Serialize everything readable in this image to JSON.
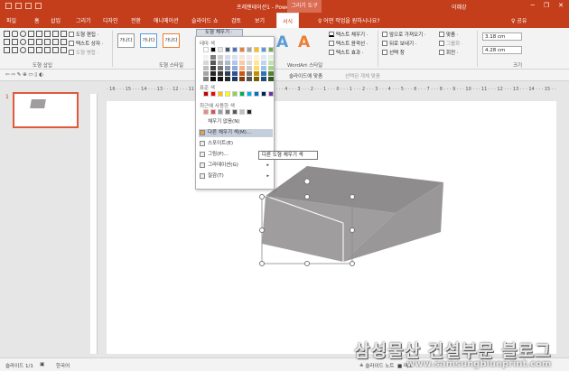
{
  "titlebar": {
    "title": "프레젠테이션1 - PowerPoint",
    "contextual_tab": "그리기 도구",
    "user": "이혜강",
    "minimize": "─",
    "restore": "❐",
    "close": "✕"
  },
  "tabs": {
    "items": [
      "파일",
      "홈",
      "삽입",
      "그리기",
      "디자인",
      "전환",
      "애니메이션",
      "슬라이드 쇼",
      "검토",
      "보기"
    ],
    "active": "서식",
    "tell_me": "♀ 어떤 작업을 원하시나요?",
    "share": "♀ 공유"
  },
  "ribbon": {
    "groups": {
      "insert_shapes": "도형 삽입",
      "shape_styles": "도형 스타일",
      "wordart_styles": "WordArt 스타일",
      "size": "크기"
    },
    "buttons": {
      "edit_shape": "도형 편집 ·",
      "text_box": "텍스트 상자 ·",
      "merge_shapes": "도형 병합 ·",
      "text_fill": "텍스트 채우기 ·",
      "text_outline": "텍스트 윤곽선 ·",
      "text_effects": "텍스트 효과 ·",
      "bring_forward": "앞으로 가져오기 ·",
      "send_backward": "뒤로 보내기 ·",
      "selection_pane": "선택 창",
      "align": "맞춤 ·",
      "group": "그룹화 ·",
      "rotate": "회전 ·"
    },
    "style_swatch_label": "가나다",
    "height": "3.18 cm",
    "width": "4.28 cm"
  },
  "toolbar2": {
    "fit_slide": "슬라이드에 맞춤",
    "show_selection": "선택된 개체 맞춤"
  },
  "slide_number": "1",
  "ruler_h": "· 16 · · · 15 · · · 14 · · · 13 · · · 12 · · · 11 · · · 10 · · · 9 · · · 8 · · · 7 · · · 6 · · · 5 · · · 4 · · · 3 · · · 2 · · · 1 · · · 0 · · · 1 · · · 2 · · · 3 · · · 4 · · · 5 · · · 6 · · · 7 · · · 8 · · · 9 · · · 10 · · · 11 · · · 12 · · · 13 · · · 14 · · · 15 · · · 16",
  "dropdown": {
    "head": "도형 채우기 ·",
    "theme_colors_label": "테마 색",
    "standard_colors_label": "표준 색",
    "recent_colors_label": "최근에 사용한 색",
    "no_fill": "채우기 없음(N)",
    "more_colors": "다른 채우기 색(M)...",
    "eyedropper": "스포이트(E)",
    "picture": "그림(P)...",
    "gradient": "그라데이션(G)",
    "texture": "질감(T)",
    "theme_top": [
      "#ffffff",
      "#000000",
      "#e7e6e6",
      "#44546a",
      "#4472c4",
      "#ed7d31",
      "#a5a5a5",
      "#ffc000",
      "#5b9bd5",
      "#70ad47"
    ],
    "theme_shades": [
      [
        "#f2f2f2",
        "#d8d8d8",
        "#bfbfbf",
        "#a5a5a5",
        "#7f7f7f"
      ],
      [
        "#7f7f7f",
        "#595959",
        "#3f3f3f",
        "#262626",
        "#0c0c0c"
      ],
      [
        "#d0cece",
        "#aeabab",
        "#757070",
        "#3a3838",
        "#171616"
      ],
      [
        "#d6dce4",
        "#adb9ca",
        "#8496b0",
        "#323f4f",
        "#222a35"
      ],
      [
        "#d9e2f3",
        "#b4c6e7",
        "#8eaadb",
        "#2f5496",
        "#1f3864"
      ],
      [
        "#fbe5d5",
        "#f7cbac",
        "#f4b183",
        "#c55a11",
        "#833c0b"
      ],
      [
        "#ededed",
        "#dbdbdb",
        "#c9c9c9",
        "#7b7b7b",
        "#525252"
      ],
      [
        "#fff2cc",
        "#fee599",
        "#ffd965",
        "#bf9000",
        "#7f6000"
      ],
      [
        "#deebf6",
        "#bdd7ee",
        "#9dc3e6",
        "#2e75b5",
        "#1e4e79"
      ],
      [
        "#e2efd9",
        "#c5e0b3",
        "#a8d08d",
        "#538135",
        "#375623"
      ]
    ],
    "standard": [
      "#c00000",
      "#ff0000",
      "#ffc000",
      "#ffff00",
      "#92d050",
      "#00b050",
      "#00b0f0",
      "#0070c0",
      "#002060",
      "#7030a0"
    ],
    "recent": [
      "#e88a8a",
      "#e05050",
      "#a09d9e",
      "#7f7f7f",
      "#595959",
      "#bfbfbf",
      "#262626"
    ]
  },
  "tooltip": "다른 도형 채우기 색",
  "statusbar": {
    "slide": "슬라이드 1/1",
    "language": "한국어",
    "notes": "≜ 슬라이드 노트",
    "comments": "■ 메모"
  },
  "watermark": {
    "text": "삼성물산 건설부문 블로그",
    "url": "www.samsungblueprint.com"
  },
  "colors": {
    "accent": "#c43e1c",
    "shape_fill": "#a09d9e",
    "shape_top": "#8f8c8d",
    "selection": "#808080"
  }
}
